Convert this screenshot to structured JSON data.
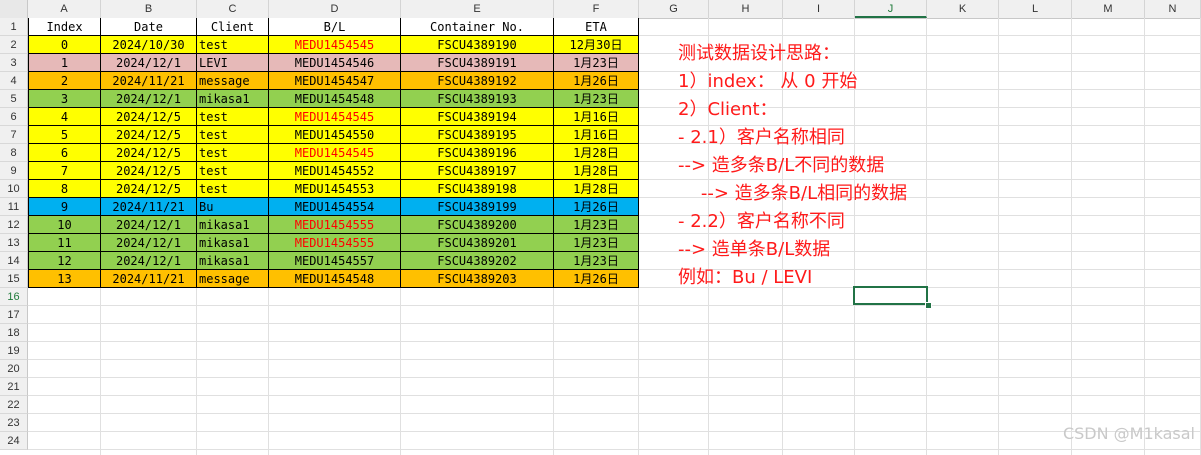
{
  "column_letters": [
    "A",
    "B",
    "C",
    "D",
    "E",
    "F",
    "G",
    "H",
    "I",
    "J",
    "K",
    "L",
    "M",
    "N"
  ],
  "row_numbers": [
    "1",
    "2",
    "3",
    "4",
    "5",
    "6",
    "7",
    "8",
    "9",
    "10",
    "11",
    "12",
    "13",
    "14",
    "15",
    "16",
    "17",
    "18",
    "19",
    "20",
    "21",
    "22",
    "23",
    "24"
  ],
  "active_cell": {
    "column": "J",
    "row": "16"
  },
  "table": {
    "headers": [
      "Index",
      "Date",
      "Client",
      "B/L",
      "Container No.",
      "ETA"
    ],
    "rows": [
      {
        "index": "0",
        "date": "2024/10/30",
        "client": "test",
        "bl": "MEDU1454545",
        "bl_red": true,
        "container": "FSCU4389190",
        "eta": "12月30日",
        "fill": "#ffff00"
      },
      {
        "index": "1",
        "date": "2024/12/1",
        "client": "LEVI",
        "bl": "MEDU1454546",
        "bl_red": false,
        "container": "FSCU4389191",
        "eta": "1月23日",
        "fill": "#e6b9b8"
      },
      {
        "index": "2",
        "date": "2024/11/21",
        "client": "message",
        "bl": "MEDU1454547",
        "bl_red": false,
        "container": "FSCU4389192",
        "eta": "1月26日",
        "fill": "#ffc000"
      },
      {
        "index": "3",
        "date": "2024/12/1",
        "client": "mikasa1",
        "bl": "MEDU1454548",
        "bl_red": false,
        "container": "FSCU4389193",
        "eta": "1月23日",
        "fill": "#92d050"
      },
      {
        "index": "4",
        "date": "2024/12/5",
        "client": "test",
        "bl": "MEDU1454545",
        "bl_red": true,
        "container": "FSCU4389194",
        "eta": "1月16日",
        "fill": "#ffff00"
      },
      {
        "index": "5",
        "date": "2024/12/5",
        "client": "test",
        "bl": "MEDU1454550",
        "bl_red": false,
        "container": "FSCU4389195",
        "eta": "1月16日",
        "fill": "#ffff00"
      },
      {
        "index": "6",
        "date": "2024/12/5",
        "client": "test",
        "bl": "MEDU1454545",
        "bl_red": true,
        "container": "FSCU4389196",
        "eta": "1月28日",
        "fill": "#ffff00"
      },
      {
        "index": "7",
        "date": "2024/12/5",
        "client": "test",
        "bl": "MEDU1454552",
        "bl_red": false,
        "container": "FSCU4389197",
        "eta": "1月28日",
        "fill": "#ffff00"
      },
      {
        "index": "8",
        "date": "2024/12/5",
        "client": "test",
        "bl": "MEDU1454553",
        "bl_red": false,
        "container": "FSCU4389198",
        "eta": "1月28日",
        "fill": "#ffff00"
      },
      {
        "index": "9",
        "date": "2024/11/21",
        "client": "Bu",
        "bl": "MEDU1454554",
        "bl_red": false,
        "container": "FSCU4389199",
        "eta": "1月26日",
        "fill": "#00b0f0"
      },
      {
        "index": "10",
        "date": "2024/12/1",
        "client": "mikasa1",
        "bl": "MEDU1454555",
        "bl_red": true,
        "container": "FSCU4389200",
        "eta": "1月23日",
        "fill": "#92d050"
      },
      {
        "index": "11",
        "date": "2024/12/1",
        "client": "mikasa1",
        "bl": "MEDU1454555",
        "bl_red": true,
        "container": "FSCU4389201",
        "eta": "1月23日",
        "fill": "#92d050"
      },
      {
        "index": "12",
        "date": "2024/12/1",
        "client": "mikasa1",
        "bl": "MEDU1454557",
        "bl_red": false,
        "container": "FSCU4389202",
        "eta": "1月23日",
        "fill": "#92d050"
      },
      {
        "index": "13",
        "date": "2024/11/21",
        "client": "message",
        "bl": "MEDU1454548",
        "bl_red": false,
        "container": "FSCU4389203",
        "eta": "1月26日",
        "fill": "#ffc000"
      }
    ]
  },
  "notes": [
    "测试数据设计思路：",
    "1）index： 从 0 开始",
    "2）Client：",
    "- 2.1）客户名称相同",
    "--> 造多条B/L不同的数据",
    "    --> 造多条B/L相同的数据",
    "- 2.2）客户名称不同",
    "--> 造单条B/L数据",
    "例如：Bu / LEVI"
  ],
  "watermark": "CSDN @M1kasal",
  "colors": {
    "note_text": "#ff1a1a",
    "red_bl": "#ff0000",
    "selection": "#217346"
  }
}
